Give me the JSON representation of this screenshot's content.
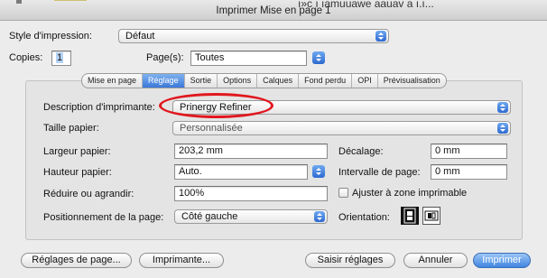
{
  "window": {
    "title": "Imprimer Mise en page 1",
    "ghost_text": "ı»c ı ıamuuawe aauav a ı.ı..."
  },
  "style": {
    "label": "Style d'impression:",
    "value": "Défaut"
  },
  "copies": {
    "label": "Copies:",
    "value": "1"
  },
  "pages": {
    "label": "Page(s):",
    "value": "Toutes"
  },
  "tabs": [
    "Mise en page",
    "Réglage",
    "Sortie",
    "Options",
    "Calques",
    "Fond perdu",
    "OPI",
    "Prévisualisation"
  ],
  "active_tab": "Réglage",
  "form": {
    "printer_desc": {
      "label": "Description d'imprimante:",
      "value": "Prinergy Refiner"
    },
    "paper_size": {
      "label": "Taille papier:",
      "value": "Personnalisée"
    },
    "paper_width": {
      "label": "Largeur papier:",
      "value": "203,2 mm"
    },
    "paper_height": {
      "label": "Hauteur papier:",
      "value": "Auto."
    },
    "scale": {
      "label": "Réduire ou agrandir:",
      "value": "100%"
    },
    "page_position": {
      "label": "Positionnement de la page:",
      "value": "Côté gauche"
    },
    "offset": {
      "label": "Décalage:",
      "value": "0 mm"
    },
    "page_gap": {
      "label": "Intervalle de page:",
      "value": "0 mm"
    },
    "fit_printable": {
      "label": "Ajuster à zone imprimable",
      "checked": false
    },
    "orientation": {
      "label": "Orientation:"
    }
  },
  "buttons": {
    "page_setup": "Réglages de page...",
    "printer": "Imprimante...",
    "capture": "Saisir réglages",
    "cancel": "Annuler",
    "print": "Imprimer"
  },
  "colors": {
    "accent": "#3b78d8",
    "highlight_ring": "#e1171e"
  }
}
